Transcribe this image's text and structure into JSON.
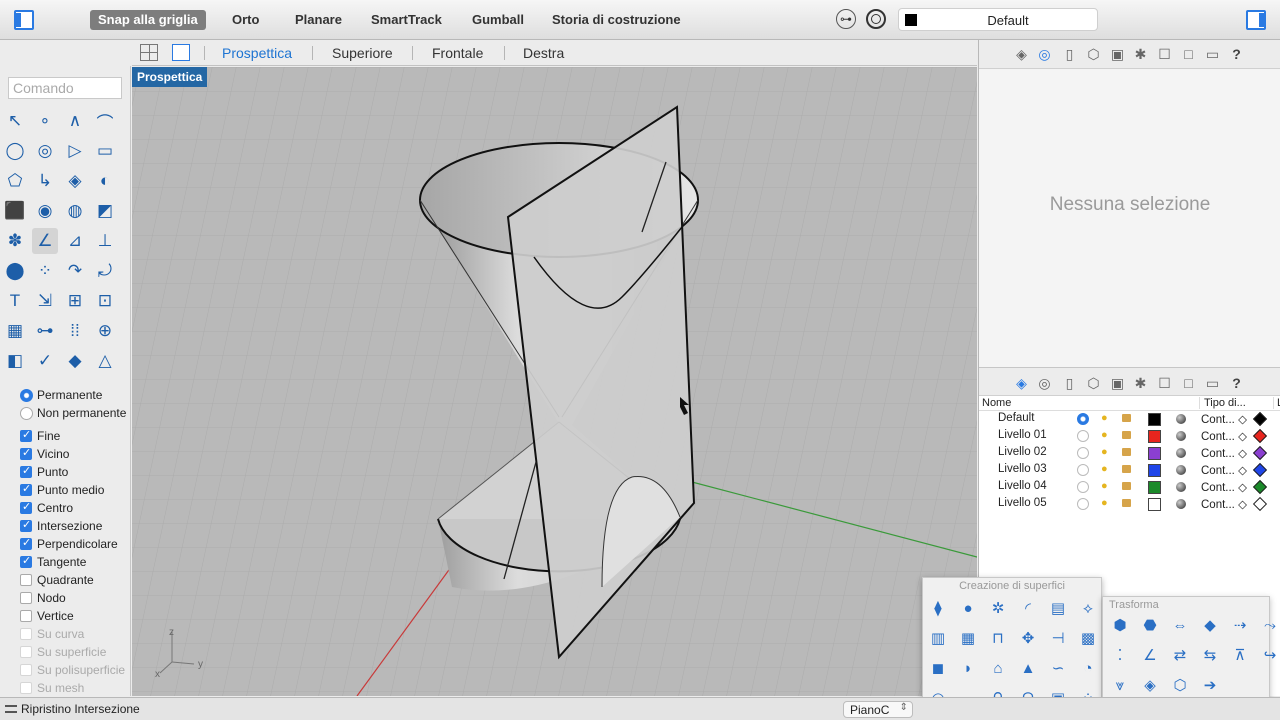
{
  "topbar": {
    "buttons": [
      "Snap alla griglia",
      "Orto",
      "Planare",
      "SmartTrack",
      "Gumball",
      "Storia di costruzione"
    ],
    "layer": "Default"
  },
  "tabs": [
    "Prospettica",
    "Superiore",
    "Frontale",
    "Destra"
  ],
  "command": {
    "placeholder": "Comando"
  },
  "viewport": {
    "label": "Prospettica",
    "axis_z": "z",
    "axis_y": "y",
    "axis_x": "x"
  },
  "osnap": {
    "modes": [
      "Permanente",
      "Non permanente"
    ],
    "options": [
      {
        "label": "Fine",
        "checked": true
      },
      {
        "label": "Vicino",
        "checked": true
      },
      {
        "label": "Punto",
        "checked": true
      },
      {
        "label": "Punto medio",
        "checked": true
      },
      {
        "label": "Centro",
        "checked": true
      },
      {
        "label": "Intersezione",
        "checked": true
      },
      {
        "label": "Perpendicolare",
        "checked": true
      },
      {
        "label": "Tangente",
        "checked": true
      },
      {
        "label": "Quadrante",
        "checked": false
      },
      {
        "label": "Nodo",
        "checked": false
      },
      {
        "label": "Vertice",
        "checked": false
      },
      {
        "label": "Su curva",
        "checked": false,
        "disabled": true
      },
      {
        "label": "Su superficie",
        "checked": false,
        "disabled": true
      },
      {
        "label": "Su polisuperficie",
        "checked": false,
        "disabled": true
      },
      {
        "label": "Su mesh",
        "checked": false,
        "disabled": true
      }
    ]
  },
  "properties": {
    "empty_text": "Nessuna selezione"
  },
  "layers": {
    "headers": [
      "Nome",
      "Tipo di...",
      "L"
    ],
    "rows": [
      {
        "name": "Default",
        "current": true,
        "color": "#000000",
        "linetype": "Cont..."
      },
      {
        "name": "Livello 01",
        "current": false,
        "color": "#e8251e",
        "linetype": "Cont..."
      },
      {
        "name": "Livello 02",
        "current": false,
        "color": "#8b3fd1",
        "linetype": "Cont..."
      },
      {
        "name": "Livello 03",
        "current": false,
        "color": "#1f45e8",
        "linetype": "Cont..."
      },
      {
        "name": "Livello 04",
        "current": false,
        "color": "#1b8a2a",
        "linetype": "Cont..."
      },
      {
        "name": "Livello 05",
        "current": false,
        "color": "#ffffff",
        "linetype": "Cont..."
      }
    ]
  },
  "floating": {
    "surface_title": "Creazione di superfici",
    "transform_title": "Trasforma"
  },
  "status": {
    "text": "Ripristino Intersezione",
    "cplane": "PianoC"
  }
}
